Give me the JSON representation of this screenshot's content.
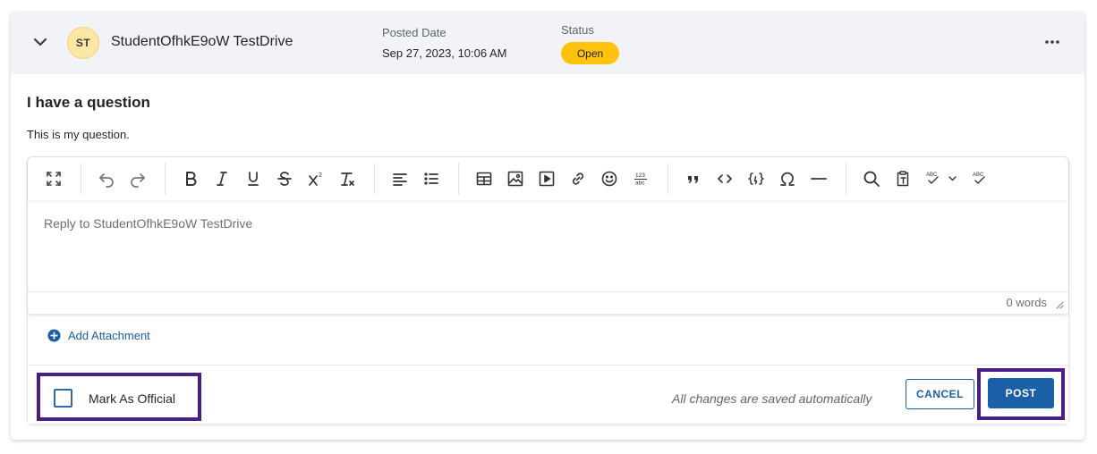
{
  "header": {
    "avatar_initials": "ST",
    "author_name": "StudentOfhkE9oW TestDrive",
    "posted_label": "Posted Date",
    "posted_value": "Sep 27, 2023, 10:06 AM",
    "status_label": "Status",
    "status_value": "Open",
    "status_color": "#ffc20e"
  },
  "post": {
    "title": "I have a question",
    "body": "This is my question."
  },
  "editor": {
    "placeholder": "Reply to StudentOfhkE9oW TestDrive",
    "word_count": "0 words",
    "toolbar_icons": [
      "fullscreen-icon",
      "undo-icon",
      "redo-icon",
      "bold-icon",
      "italic-icon",
      "underline-icon",
      "strikethrough-icon",
      "superscript-icon",
      "clear-format-icon",
      "align-left-icon",
      "bullet-list-icon",
      "table-icon",
      "image-icon",
      "video-icon",
      "link-icon",
      "emoji-icon",
      "number-format-icon",
      "blockquote-icon",
      "code-icon",
      "code-block-icon",
      "special-char-icon",
      "horizontal-rule-icon",
      "find-icon",
      "paste-text-icon",
      "spellcheck-icon",
      "spellcheck-toggle-icon"
    ],
    "numfmt_top": "123",
    "numfmt_bottom": "abc",
    "abc_label": "ABC",
    "superscript_mark": "2"
  },
  "attachment": {
    "label": "Add Attachment"
  },
  "footer": {
    "mark_official_label": "Mark As Official",
    "autosave_text": "All changes are saved automatically",
    "cancel_label": "CANCEL",
    "post_label": "POST"
  },
  "colors": {
    "accent": "#1a5fa8",
    "highlight_border": "#4b1e87",
    "header_bg": "#f2f3f7"
  }
}
